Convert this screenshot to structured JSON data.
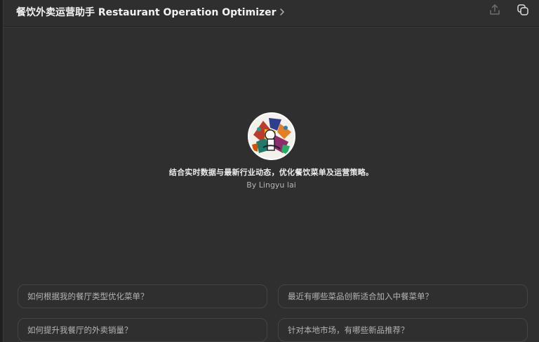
{
  "header": {
    "title": "餐饮外卖运营助手 Restaurant Operation Optimizer",
    "chevron_icon": "chevron-right-icon",
    "share_icon": "share-upload-icon",
    "new_chat_icon": "new-chat-icon"
  },
  "gpt": {
    "avatar_icon": "colorful-abstract-avatar",
    "description": "结合实时数据与最新行业动态，优化餐饮菜单及运营策略。",
    "author": "By Lingyu lai"
  },
  "suggestions": [
    {
      "label": "如何根据我的餐厅类型优化菜单？"
    },
    {
      "label": "最近有哪些菜品创新适合加入中餐菜单？"
    },
    {
      "label": "如何提升我餐厅的外卖销量？"
    },
    {
      "label": "针对本地市场，有哪些新品推荐？"
    }
  ],
  "colors": {
    "background": "#2f2f2f",
    "text_primary": "#ececec",
    "text_secondary": "#b4b4b4",
    "chip_border": "#444444"
  }
}
